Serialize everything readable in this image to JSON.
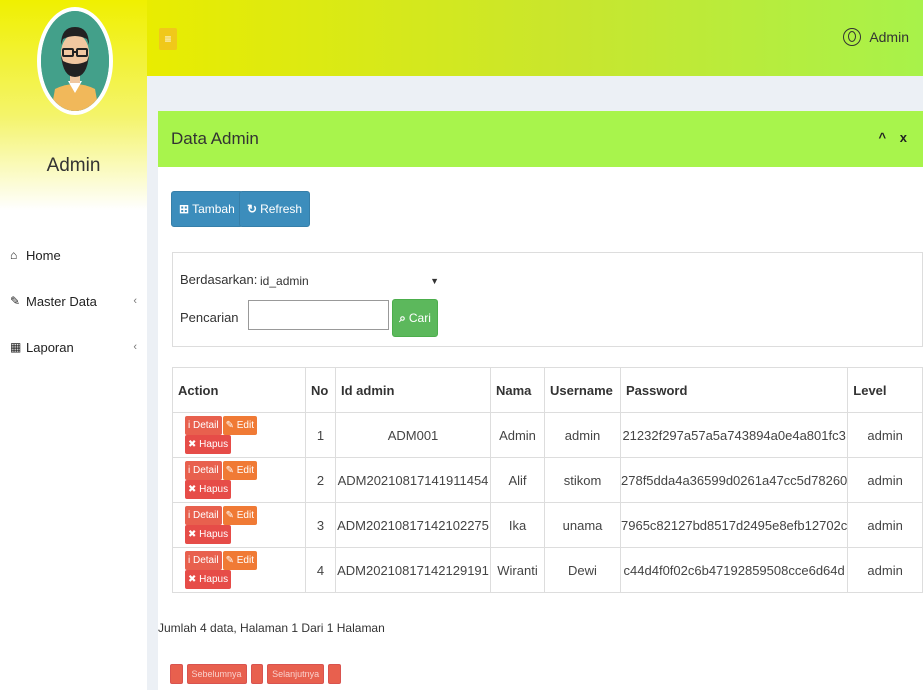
{
  "sidebar": {
    "username": "Admin",
    "items": [
      {
        "label": "Home",
        "icon": "home-icon"
      },
      {
        "label": "Master Data",
        "icon": "edit-icon"
      },
      {
        "label": "Laporan",
        "icon": "calendar-icon"
      }
    ]
  },
  "topbar": {
    "user_label": "Admin"
  },
  "panel": {
    "title": "Data Admin",
    "collapse_glyph": "^",
    "close_glyph": "x",
    "add_label": "Tambah",
    "refresh_label": "Refresh",
    "filter_label": "Berdasarkan:",
    "filter_value": "id_admin",
    "search_label": "Pencarian",
    "search_value": "",
    "search_button": "Cari"
  },
  "table": {
    "headers": [
      "Action",
      "No",
      "Id admin",
      "Nama",
      "Username",
      "Password",
      "Level"
    ],
    "action_labels": {
      "detail": "Detail",
      "edit": "Edit",
      "hapus": "Hapus"
    },
    "rows": [
      {
        "no": "1",
        "id": "ADM001",
        "nama": "Admin",
        "username": "admin",
        "password": "21232f297a57a5a743894a0e4a801fc3",
        "level": "admin"
      },
      {
        "no": "2",
        "id": "ADM20210817141911454",
        "nama": "Alif",
        "username": "stikom",
        "password": "278f5dda4a36599d0261a47cc5d78260",
        "level": "admin"
      },
      {
        "no": "3",
        "id": "ADM20210817142102275",
        "nama": "Ika",
        "username": "unama",
        "password": "7965c82127bd8517d2495e8efb12702c",
        "level": "admin"
      },
      {
        "no": "4",
        "id": "ADM20210817142129191",
        "nama": "Wiranti",
        "username": "Dewi",
        "password": "c44d4f0f02c6b47192859508cce6d64d",
        "level": "admin"
      }
    ]
  },
  "summary": "Jumlah 4 data, Halaman 1 Dari 1 Halaman",
  "pagination": {
    "prev_label": "Sebelumnya",
    "next_label": "Selanjutnya"
  },
  "colors": {
    "topbar_start": "#e9ec00",
    "topbar_end": "#a8f24a",
    "box_header": "#a8f44c",
    "primary": "#3c8dbc",
    "success": "#5cb85c",
    "danger": "#e64c48"
  }
}
